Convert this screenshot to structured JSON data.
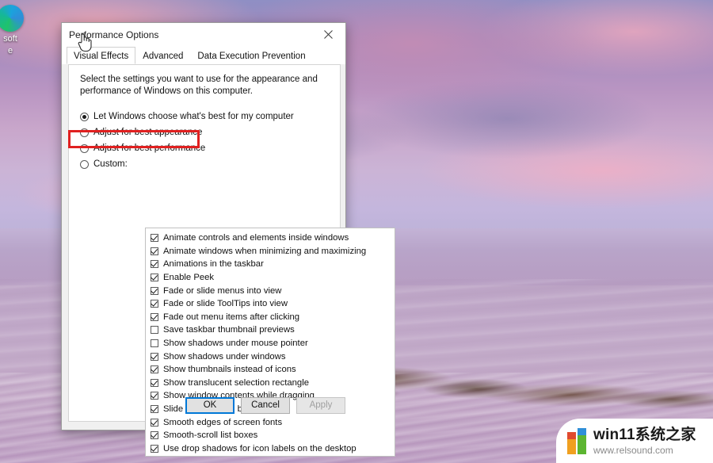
{
  "desktop": {
    "icon": {
      "name": "edge-icon",
      "label_line1": "soft",
      "label_line2": "e"
    }
  },
  "dialog": {
    "title": "Performance Options",
    "close_label": "✕",
    "tabs": [
      {
        "label": "Visual Effects",
        "active": true
      },
      {
        "label": "Advanced",
        "active": false
      },
      {
        "label": "Data Execution Prevention",
        "active": false
      }
    ],
    "intro": "Select the settings you want to use for the appearance and performance of Windows on this computer.",
    "radios": [
      {
        "label": "Let Windows choose what's best for my computer",
        "checked": true
      },
      {
        "label": "Adjust for best appearance",
        "checked": false
      },
      {
        "label": "Adjust for best performance",
        "checked": false,
        "highlighted": true
      },
      {
        "label": "Custom:",
        "checked": false
      }
    ],
    "highlight_color": "#e02020",
    "checkboxes": [
      {
        "label": "Animate controls and elements inside windows",
        "checked": true
      },
      {
        "label": "Animate windows when minimizing and maximizing",
        "checked": true
      },
      {
        "label": "Animations in the taskbar",
        "checked": true
      },
      {
        "label": "Enable Peek",
        "checked": true
      },
      {
        "label": "Fade or slide menus into view",
        "checked": true
      },
      {
        "label": "Fade or slide ToolTips into view",
        "checked": true
      },
      {
        "label": "Fade out menu items after clicking",
        "checked": true
      },
      {
        "label": "Save taskbar thumbnail previews",
        "checked": false
      },
      {
        "label": "Show shadows under mouse pointer",
        "checked": false
      },
      {
        "label": "Show shadows under windows",
        "checked": true
      },
      {
        "label": "Show thumbnails instead of icons",
        "checked": true
      },
      {
        "label": "Show translucent selection rectangle",
        "checked": true
      },
      {
        "label": "Show window contents while dragging",
        "checked": true
      },
      {
        "label": "Slide open combo boxes",
        "checked": true
      },
      {
        "label": "Smooth edges of screen fonts",
        "checked": true
      },
      {
        "label": "Smooth-scroll list boxes",
        "checked": true
      },
      {
        "label": "Use drop shadows for icon labels on the desktop",
        "checked": true
      }
    ],
    "buttons": {
      "ok": "OK",
      "cancel": "Cancel",
      "apply": "Apply"
    }
  },
  "watermark": {
    "title": "win11系统之家",
    "url": "www.relsound.com"
  }
}
